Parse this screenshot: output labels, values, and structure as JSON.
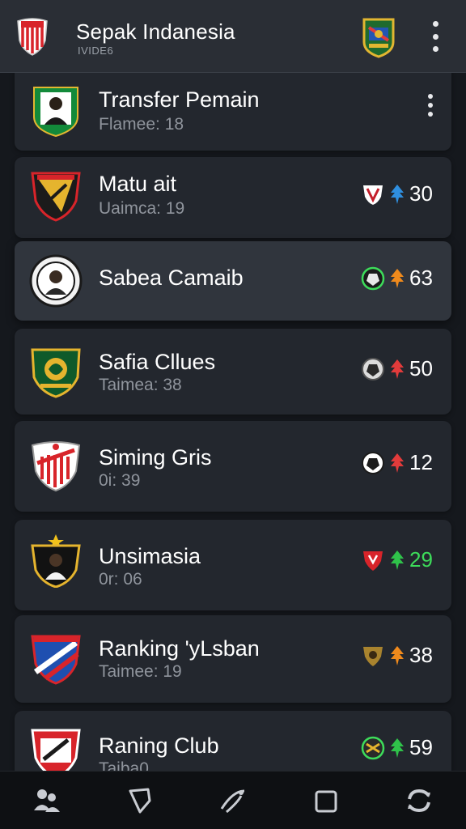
{
  "app": {
    "title": "Sepak Indanesia",
    "subtitle": "IVIDE6"
  },
  "clubs": [
    {
      "name": "Transfer Pemain",
      "meta": "Flamee:  18",
      "has_menu": true
    },
    {
      "name": "Matu ait",
      "meta": "Uaimca:  19",
      "stat": "30",
      "arrow_color": "#2f8fe0"
    },
    {
      "name": "Sabea Camaib",
      "meta": "",
      "stat": "63",
      "arrow_color": "#f08a1c",
      "selected": true
    },
    {
      "name": "Safia Cllues",
      "meta": "Taimea: 38",
      "stat": "50",
      "arrow_color": "#e23b3b"
    },
    {
      "name": "Siming Gris",
      "meta": "0i: 39",
      "stat": "12",
      "arrow_color": "#e23b3b"
    },
    {
      "name": "Unsimasia",
      "meta": "0r:  06",
      "stat": "29",
      "arrow_color": "#2fc24a",
      "stat_color": "#3ddc5a"
    },
    {
      "name": "Ranking 'yLsban",
      "meta": "Taimee: 19",
      "stat": "38",
      "arrow_color": "#f08a1c"
    },
    {
      "name": "Raning Club",
      "meta": "Taiba0",
      "stat": "59",
      "arrow_color": "#2fc24a"
    }
  ],
  "nav": [
    {
      "icon": "players-icon"
    },
    {
      "icon": "shield-icon"
    },
    {
      "icon": "whistle-icon"
    },
    {
      "icon": "square-icon"
    },
    {
      "icon": "refresh-icon"
    }
  ],
  "colors": {
    "background": "#15181d",
    "card": "#23272e",
    "card_selected": "#30353d",
    "appbar": "#2a2e35"
  }
}
